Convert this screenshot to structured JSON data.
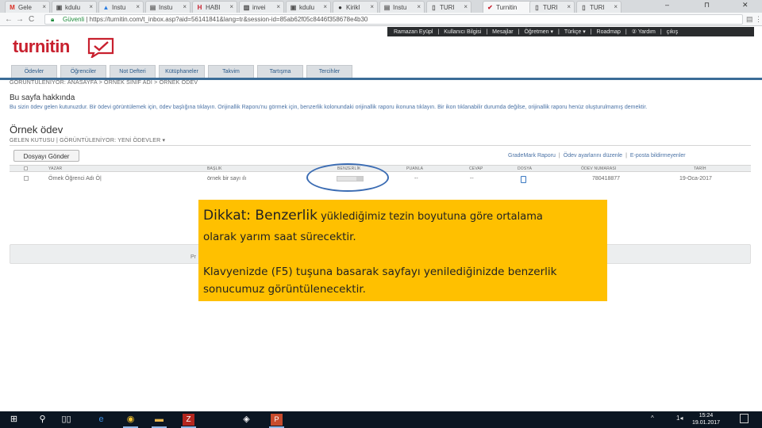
{
  "browser": {
    "tabs": [
      {
        "label": "Gele",
        "fav": "M",
        "fav_color": "#d93025"
      },
      {
        "label": "kdulu",
        "fav": "▣",
        "fav_color": "#555555"
      },
      {
        "label": "Instu",
        "fav": "▲",
        "fav_color": "#2a7de1"
      },
      {
        "label": "Instu",
        "fav": "▤",
        "fav_color": "#666666"
      },
      {
        "label": "HABI",
        "fav": "H",
        "fav_color": "#c8202e"
      },
      {
        "label": "invei",
        "fav": "▥",
        "fav_color": "#444444"
      },
      {
        "label": "kdulu",
        "fav": "▣",
        "fav_color": "#555555"
      },
      {
        "label": "Kirikl",
        "fav": "●",
        "fav_color": "#333333"
      },
      {
        "label": "Instu",
        "fav": "▤",
        "fav_color": "#666666"
      },
      {
        "label": "TURI",
        "fav": "▯",
        "fav_color": "#555555"
      },
      {
        "label": "Turnitin",
        "fav": "✔",
        "fav_color": "#c8202e"
      },
      {
        "label": "TURI",
        "fav": "▯",
        "fav_color": "#555555"
      },
      {
        "label": "TURI",
        "fav": "▯",
        "fav_color": "#555555"
      }
    ],
    "close_glyph": "×",
    "window_controls": {
      "minimize": "–",
      "restore": "⊓",
      "close": "✕"
    },
    "nav": {
      "back": "←",
      "forward": "→",
      "reload": "C"
    },
    "address": {
      "secure_label": "Güvenli",
      "url": "| https://turnitin.com/t_inbox.asp?aid=56141841&lang=tr&session-id=85ab62f05c8446f358678e4b30"
    },
    "toolbar_icons": {
      "extension": "▤",
      "menu": "⋮"
    }
  },
  "turnitin": {
    "logo_text": "turnitin",
    "top_nav": [
      "Ramazan Eyüpl",
      "|",
      "Kullanıcı Bilgisi",
      "|",
      "Mesajlar",
      "|",
      "Öğretmen ▾",
      "|",
      "Türkçe ▾",
      "|",
      "Roadmap",
      "|",
      "② Yardım",
      "|",
      "çıkış"
    ],
    "main_tabs": [
      "Ödevler",
      "Öğrenciler",
      "Not Defteri",
      "Kütüphaneler",
      "Takvim",
      "Tartışma",
      "Tercihler"
    ],
    "breadcrumb": "GORÜNTÜLENIYOR: ANASAYFA > ÖRNEK SINIF ADI > ÖRNEK ÖDEV",
    "about_title": "Bu sayfa hakkında",
    "about_text": "Bu sizin ödev gelen kutunuzdur. Bir ödevi görüntülemek için, ödev başlığına tıklayın. Orijinallik Raporu'nu görmek için, benzerlik kolonundaki orijinallik raporu ikonuna tıklayın. Bir ikon tıklanabilir durumda değilse, orijinallik raporu henüz oluşturulmamış demektir.",
    "page_title": "Örnek ödev",
    "sub_crumb": "GELEN KUTUSU | GÖRÜNTÜLENİYOR: YENİ ÖDEVLER ▾",
    "submit_button": "Dosyayı Gönder",
    "table_links": [
      "GradeMark Raporu",
      "Ödev ayarlarını düzenle",
      "E-posta bildirmeyenler"
    ],
    "columns": [
      "YAZAR",
      "BAŞLIK",
      "BENZERLİK",
      "PUANLA",
      "CEVAP",
      "DOSYA",
      "ÖDEV NUMARASI",
      "TARİH"
    ],
    "row": {
      "author": "Örnek Öğrenci Adı Ö|",
      "title": "örnek bir sayı ılı",
      "score": "--",
      "response": "--",
      "paper_id": "780418877",
      "date": "19-Oca-2017"
    },
    "grey_fragment": "Pr"
  },
  "notice": {
    "title_big": "Dikkat: Benzerlik",
    "title_rest": " yüklediğimiz tezin boyutuna göre  ortalama",
    "line2": "olarak  yarım saat sürecektir.",
    "line3": "Klavyenizde (F5) tuşuna basarak sayfayı yenilediğinizde benzerlik",
    "line4": "sonucumuz  görüntülenecektir."
  },
  "taskbar": {
    "apps": [
      {
        "name": "start",
        "glyph": "⊞"
      },
      {
        "name": "search",
        "glyph": "⚲"
      },
      {
        "name": "task-view",
        "glyph": "▯▯"
      },
      {
        "name": "edge",
        "glyph": "e"
      },
      {
        "name": "chrome",
        "glyph": "◉"
      },
      {
        "name": "explorer",
        "glyph": "▬"
      },
      {
        "name": "filezilla",
        "glyph": "Z"
      },
      {
        "name": "box",
        "glyph": "◈"
      },
      {
        "name": "powerpoint",
        "glyph": "P"
      }
    ],
    "tray": {
      "chevron": "^",
      "volume": "1◂"
    },
    "time": "15:24",
    "date": "19.01.2017",
    "colors": {
      "bar": "#0b1622",
      "notice": "#ffc000",
      "brand": "#c8202e",
      "link": "#4a72a5"
    }
  }
}
